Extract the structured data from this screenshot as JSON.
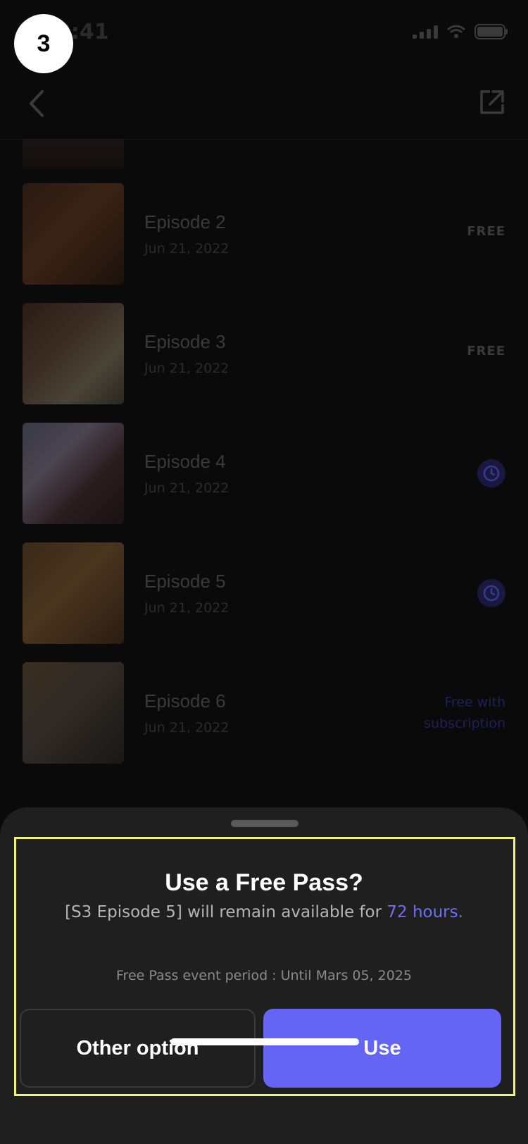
{
  "step_badge": "3",
  "status_bar": {
    "time": "9:41"
  },
  "header": {
    "back_icon": "chevron-left-icon",
    "share_icon": "share-icon"
  },
  "episodes": [
    {
      "title": "Episode 2",
      "date": "Jun 21, 2022",
      "status": "FREE"
    },
    {
      "title": "Episode 3",
      "date": "Jun 21, 2022",
      "status": "FREE"
    },
    {
      "title": "Episode 4",
      "date": "Jun 21, 2022",
      "status_icon": "clock-icon"
    },
    {
      "title": "Episode 5",
      "date": "Jun 21, 2022",
      "status_icon": "clock-icon"
    },
    {
      "title": "Episode 6",
      "date": "Jun 21, 2022",
      "status": "Free with subscription"
    }
  ],
  "sheet": {
    "title": "Use a Free Pass?",
    "message_prefix": "[S3 Episode 5] will remain available for ",
    "message_highlight": "72 hours.",
    "period": "Free Pass event period : Until Mars 05, 2025",
    "other_label": "Other option",
    "use_label": "Use"
  },
  "colors": {
    "accent": "#6464f5",
    "highlight_border": "#f1f27a",
    "sheet_bg": "#1f1f1f",
    "backdrop": "#0a0a0a"
  }
}
